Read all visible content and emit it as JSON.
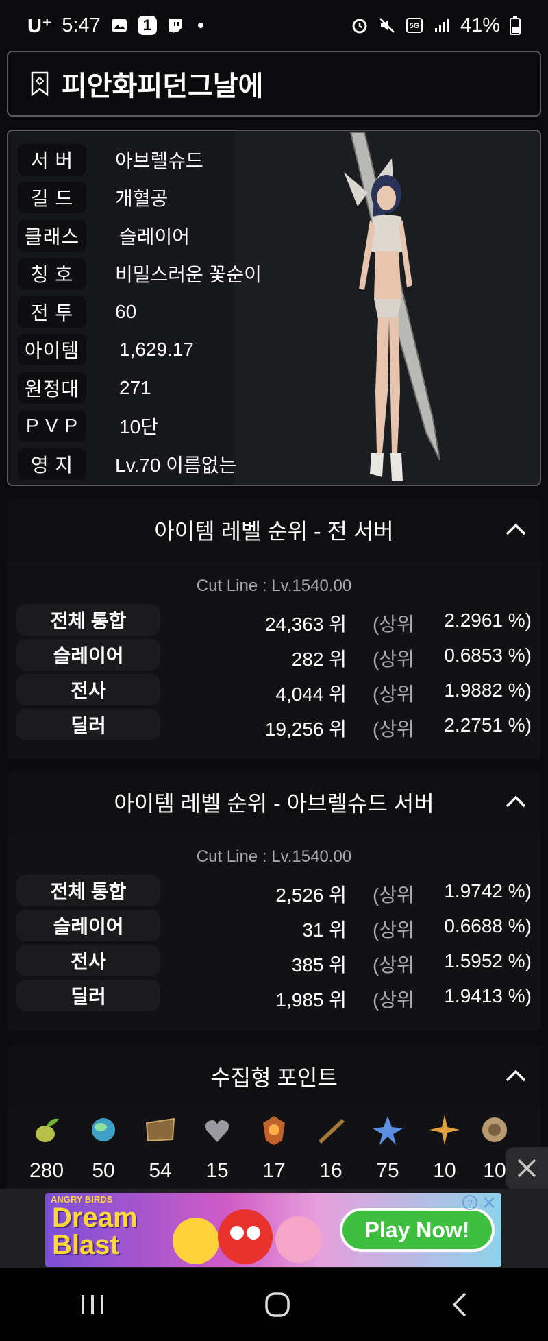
{
  "status_bar": {
    "carrier": "U⁺",
    "time": "5:47",
    "notif_badge": "1",
    "battery": "41%"
  },
  "character": {
    "name": "피안화피던그날에"
  },
  "profile": {
    "rows": [
      {
        "key": "서  버",
        "value": "아브렐슈드"
      },
      {
        "key": "길  드",
        "value": "개혈공"
      },
      {
        "key": "클래스",
        "value": "슬레이어"
      },
      {
        "key": "칭  호",
        "value": "비밀스러운 꽃순이"
      },
      {
        "key": "전  투",
        "value": "60"
      },
      {
        "key": "아이템",
        "value": "1,629.17"
      },
      {
        "key": "원정대",
        "value": "271"
      },
      {
        "key": "P V P",
        "value": "10단"
      },
      {
        "key": "영  지",
        "value": "Lv.70 이름없는"
      }
    ]
  },
  "ranking_all": {
    "title": "아이템 레벨 순위 - 전 서버",
    "cut_line": "Cut Line : Lv.1540.00",
    "rows": [
      {
        "label": "전체 통합",
        "rank": "24,363 위",
        "top": "(상위",
        "pct": "2.2961 %)"
      },
      {
        "label": "슬레이어",
        "rank": "282 위",
        "top": "(상위",
        "pct": "0.6853 %)"
      },
      {
        "label": "전사",
        "rank": "4,044 위",
        "top": "(상위",
        "pct": "1.9882 %)"
      },
      {
        "label": "딜러",
        "rank": "19,256 위",
        "top": "(상위",
        "pct": "2.2751 %)"
      }
    ]
  },
  "ranking_server": {
    "title": "아이템 레벨 순위 - 아브렐슈드 서버",
    "cut_line": "Cut Line : Lv.1540.00",
    "rows": [
      {
        "label": "전체 통합",
        "rank": "2,526 위",
        "top": "(상위",
        "pct": "1.9742 %)"
      },
      {
        "label": "슬레이어",
        "rank": "31 위",
        "top": "(상위",
        "pct": "0.6688 %)"
      },
      {
        "label": "전사",
        "rank": "385 위",
        "top": "(상위",
        "pct": "1.5952 %)"
      },
      {
        "label": "딜러",
        "rank": "1,985 위",
        "top": "(상위",
        "pct": "1.9413 %)"
      }
    ]
  },
  "collection": {
    "title": "수집형 포인트",
    "items": [
      {
        "icon": "mokoko-seed-icon",
        "count": "280"
      },
      {
        "icon": "island-heart-icon",
        "count": "50"
      },
      {
        "icon": "great-art-icon",
        "count": "54"
      },
      {
        "icon": "giant-heart-icon",
        "count": "15"
      },
      {
        "icon": "ignea-token-icon",
        "count": "17"
      },
      {
        "icon": "adventure-voyage-icon",
        "count": "16"
      },
      {
        "icon": "world-tree-leaf-icon",
        "count": "75"
      },
      {
        "icon": "orpheus-star-icon",
        "count": "10"
      },
      {
        "icon": "omnium-star-icon",
        "count": "10"
      }
    ]
  },
  "ad": {
    "brand": "ANGRY BIRDS",
    "title_line1": "Dream",
    "title_line2": "Blast",
    "cta": "Play Now!"
  },
  "colors": {
    "background": "#0b0b0d",
    "panel": "#121214",
    "border": "#5a5a5e",
    "muted": "#a9a9ad"
  }
}
